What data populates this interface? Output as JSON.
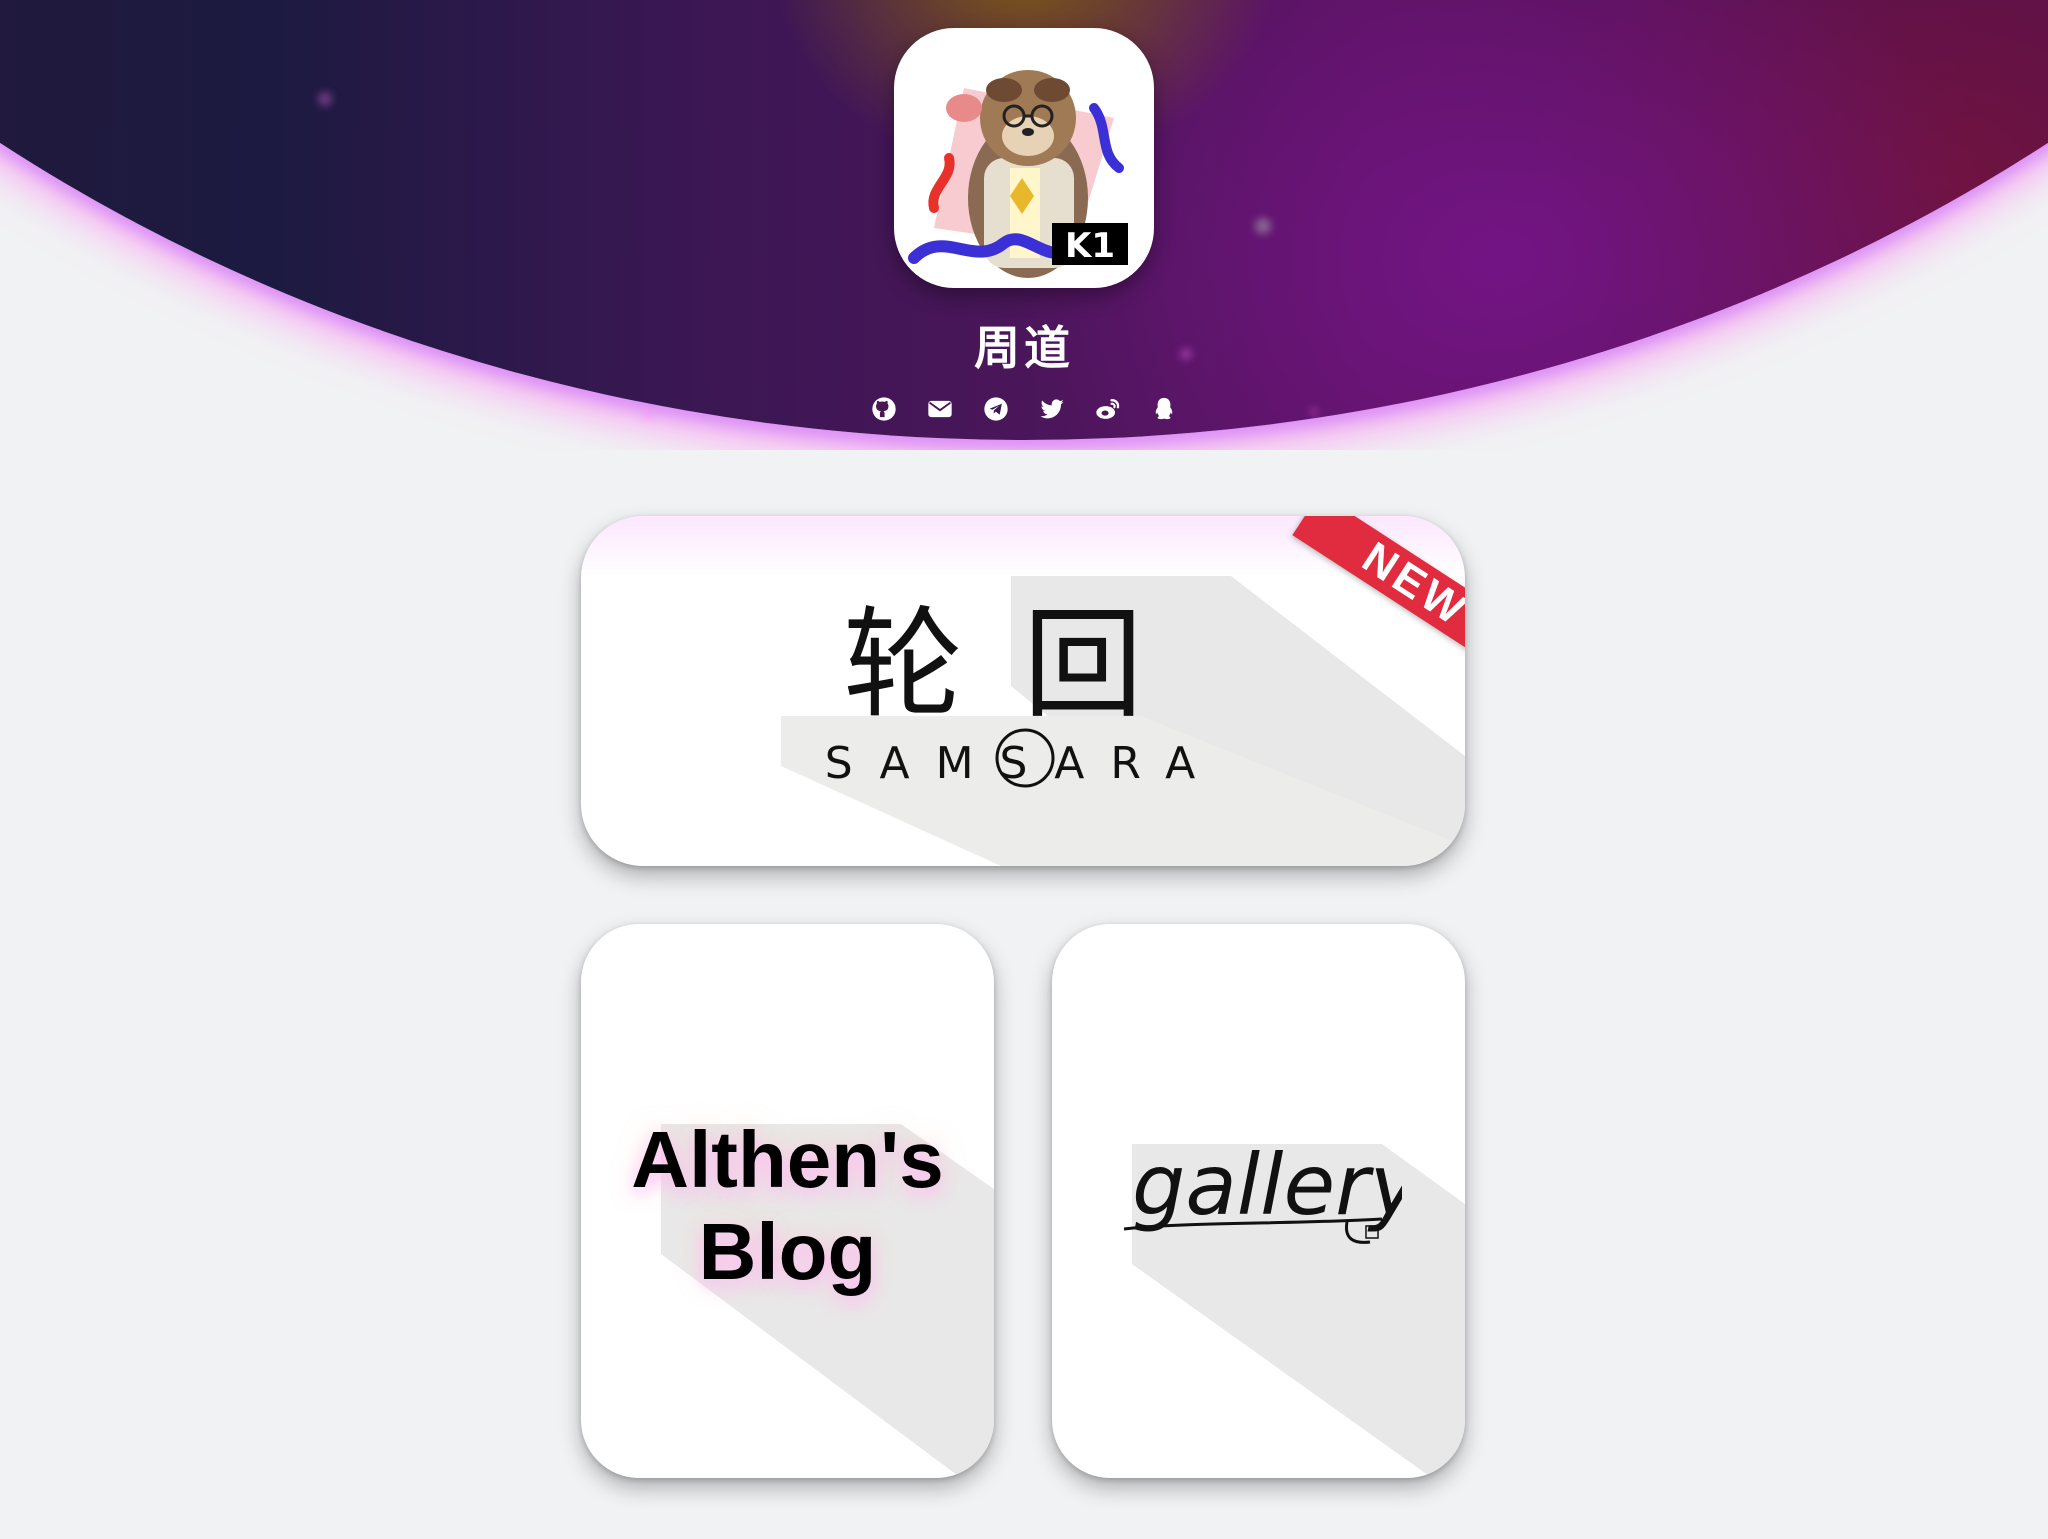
{
  "profile": {
    "name": "周道",
    "avatar_badge": "K1"
  },
  "socials": [
    {
      "name": "github-icon"
    },
    {
      "name": "mail-icon"
    },
    {
      "name": "telegram-icon"
    },
    {
      "name": "twitter-icon"
    },
    {
      "name": "weibo-icon"
    },
    {
      "name": "qq-icon"
    }
  ],
  "cards": {
    "featured": {
      "badge": "NEW",
      "title": "轮回",
      "subtitle": "SAMSARA"
    },
    "blog": {
      "title_line1": "Althen's",
      "title_line2": "Blog"
    },
    "gallery": {
      "title": "gallery"
    }
  },
  "colors": {
    "accent_pink": "#ff7ef5",
    "ribbon_red": "#e12b3e",
    "hero_dark": "#2e1638",
    "hero_purple": "#5a1460"
  }
}
